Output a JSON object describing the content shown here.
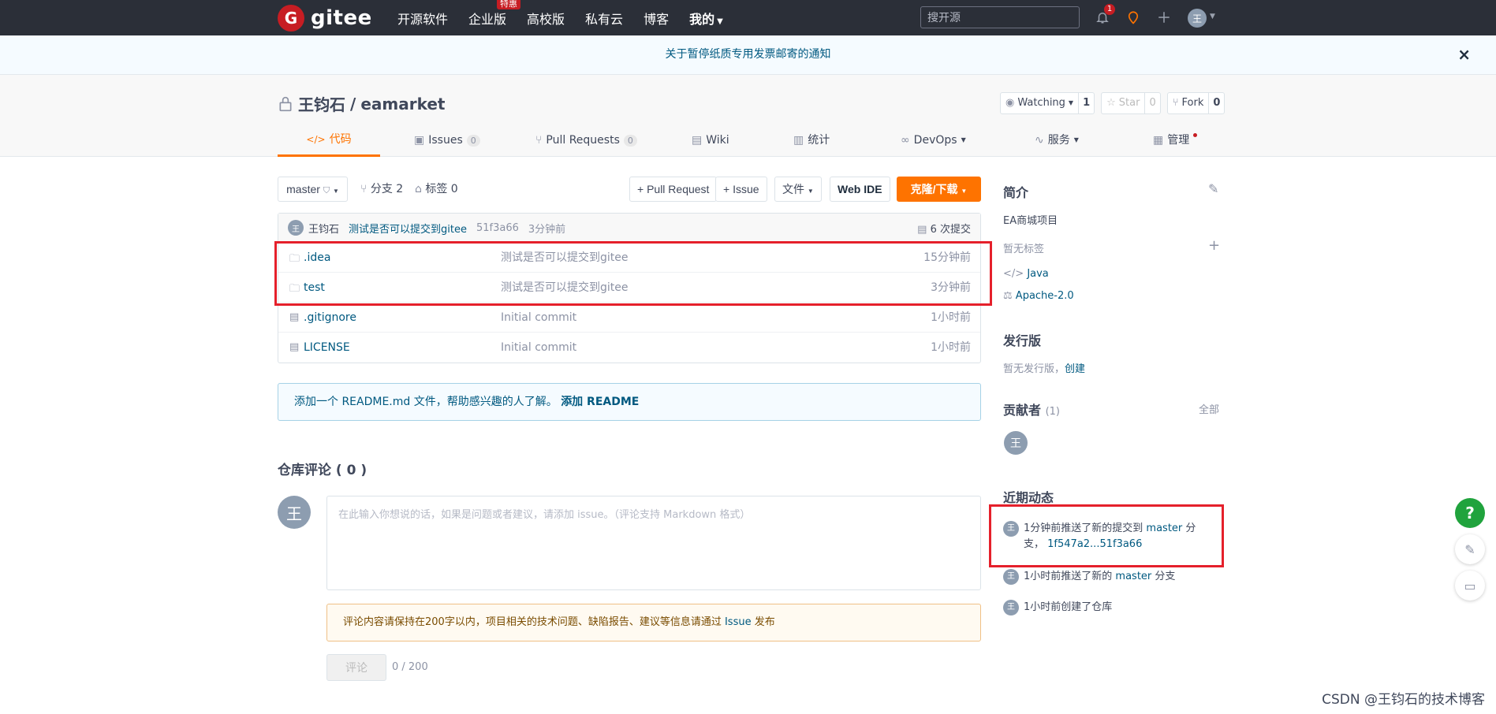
{
  "nav": {
    "logo_letter": "G",
    "logo_text": "gitee",
    "links": [
      {
        "label": "开源软件"
      },
      {
        "label": "企业版",
        "badge": "特惠"
      },
      {
        "label": "高校版"
      },
      {
        "label": "私有云"
      },
      {
        "label": "博客"
      },
      {
        "label": "我的"
      }
    ],
    "search_placeholder": "搜开源",
    "notifications_count": "1",
    "avatar_letter": "王"
  },
  "notice": {
    "text": "关于暂停纸质专用发票邮寄的通知",
    "close": "×"
  },
  "repo": {
    "owner": "王钧石",
    "separator": "/",
    "name": "eamarket",
    "watching_label": "Watching",
    "watching_count": "1",
    "star_label": "Star",
    "star_count": "0",
    "fork_label": "Fork",
    "fork_count": "0"
  },
  "tabs": [
    {
      "label": "代码",
      "icon": "</>"
    },
    {
      "label": "Issues",
      "count": "0"
    },
    {
      "label": "Pull Requests",
      "count": "0"
    },
    {
      "label": "Wiki"
    },
    {
      "label": "统计"
    },
    {
      "label": "DevOps"
    },
    {
      "label": "服务"
    },
    {
      "label": "管理"
    }
  ],
  "toolbar": {
    "branch": "master",
    "branches": "分支 2",
    "tags": "标签 0",
    "pull_request": "+ Pull Request",
    "issue": "+ Issue",
    "file": "文件",
    "web_ide": "Web IDE",
    "clone": "克隆/下载"
  },
  "latest_commit": {
    "avatar": "王",
    "author": "王钧石",
    "message": "测试是否可以提交到gitee",
    "hash": "51f3a66",
    "time": "3分钟前",
    "commit_count": "6 次提交"
  },
  "files": [
    {
      "type": "folder",
      "name": ".idea",
      "message": "测试是否可以提交到gitee",
      "time": "15分钟前"
    },
    {
      "type": "folder",
      "name": "test",
      "message": "测试是否可以提交到gitee",
      "time": "3分钟前"
    },
    {
      "type": "file",
      "name": ".gitignore",
      "message": "Initial commit",
      "time": "1小时前"
    },
    {
      "type": "file",
      "name": "LICENSE",
      "message": "Initial commit",
      "time": "1小时前"
    }
  ],
  "readme_hint": {
    "text": "添加一个 README.md 文件，帮助感兴趣的人了解。",
    "link": "添加 README"
  },
  "comments": {
    "title": "仓库评论 ( 0 )",
    "avatar": "王",
    "placeholder": "在此输入你想说的话，如果是问题或者建议，请添加 issue。（评论支持 Markdown 格式）",
    "tip_prefix": "评论内容请保持在200字以内，项目相关的技术问题、缺陷报告、建议等信息请通过",
    "tip_link": "Issue",
    "tip_suffix": "发布",
    "submit": "评论",
    "char_count": "0 / 200"
  },
  "sidebar": {
    "intro_title": "简介",
    "description": "EA商城项目",
    "no_tags": "暂无标签",
    "language": "Java",
    "license": "Apache-2.0",
    "release_title": "发行版",
    "no_release": "暂无发行版，",
    "create": "创建",
    "contributors_title": "贡献者",
    "contributors_count": "(1)",
    "contributors_all": "全部",
    "contributor_avatar": "王",
    "activity_title": "近期动态",
    "activities": [
      {
        "avatar": "王",
        "prefix": "1分钟前推送了新的提交到",
        "branch": "master",
        "suffix": "分支，",
        "range": "1f547a2...51f3a66"
      },
      {
        "avatar": "王",
        "prefix": "1小时前推送了新的",
        "branch": "master",
        "suffix": "分支",
        "range": ""
      },
      {
        "avatar": "王",
        "prefix": "1小时前创建了仓库",
        "branch": "",
        "suffix": "",
        "range": ""
      }
    ]
  },
  "floating": {
    "help": "?"
  },
  "watermark": "CSDN @王钧石的技术博客",
  "colors": {
    "accent": "#fe7300",
    "brand_red": "#c71d23",
    "link": "#005980",
    "highlight_box": "#e5202b"
  }
}
